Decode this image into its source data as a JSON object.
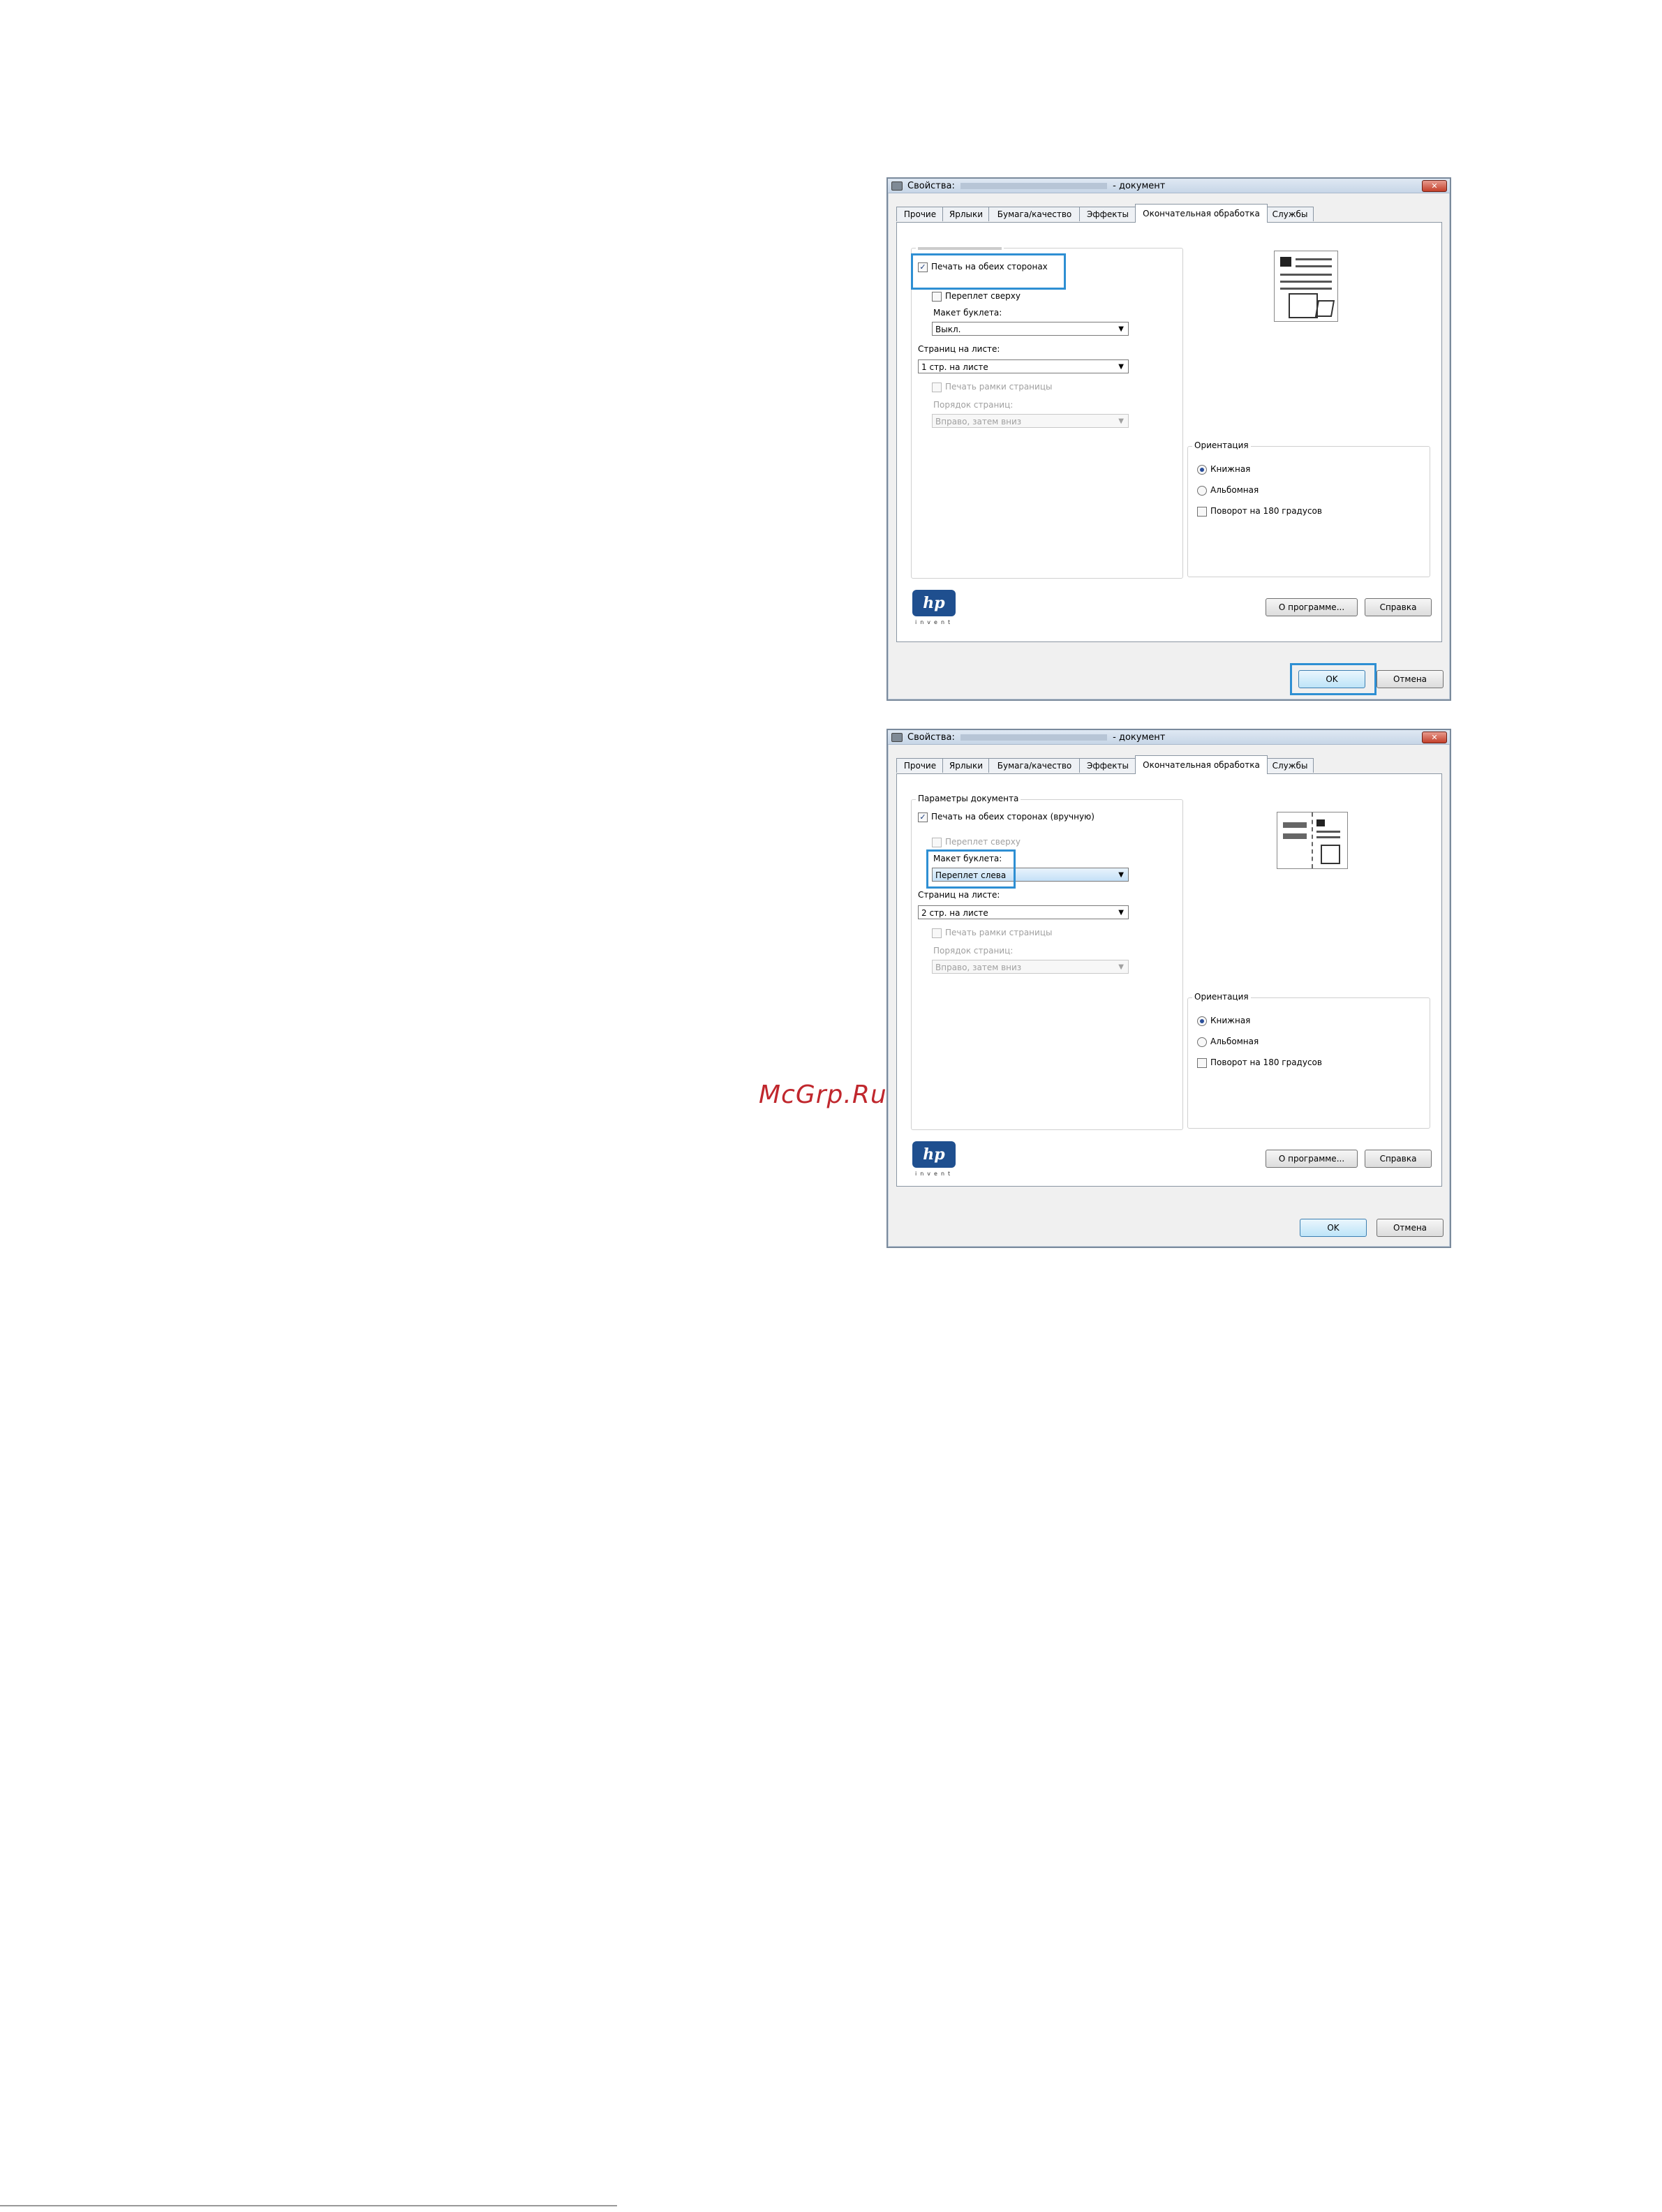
{
  "dialog1": {
    "title_prefix": "Свойства:",
    "title_suffix": "- документ",
    "close": "✕",
    "tabs": [
      "Прочие",
      "Ярлыки",
      "Бумага/качество",
      "Эффекты",
      "Окончательная обработка",
      "Службы"
    ],
    "active_tab": "Окончательная обработка",
    "doc_group_legend": "",
    "duplex_label": "Печать на обеих сторонах",
    "duplex_checked": "✓",
    "flip_label": "Переплет сверху",
    "booklet_label": "Макет буклета:",
    "booklet_value": "Выкл.",
    "pages_label": "Страниц на листе:",
    "pages_value": "1 стр. на листе",
    "border_label": "Печать рамки страницы",
    "order_label": "Порядок страниц:",
    "order_value": "Вправо, затем вниз",
    "orientation_legend": "Ориентация",
    "portrait_label": "Книжная",
    "landscape_label": "Альбомная",
    "rotate_label": "Поворот на 180 градусов",
    "about_button": "О программе...",
    "help_button": "Справка",
    "ok_button": "OK",
    "cancel_button": "Отмена"
  },
  "dialog2": {
    "title_prefix": "Свойства:",
    "title_suffix": "- документ",
    "close": "✕",
    "tabs": [
      "Прочие",
      "Ярлыки",
      "Бумага/качество",
      "Эффекты",
      "Окончательная обработка",
      "Службы"
    ],
    "active_tab": "Окончательная обработка",
    "doc_group_legend": "Параметры документа",
    "duplex_label": "Печать на обеих сторонах (вручную)",
    "duplex_checked": "✓",
    "flip_label": "Переплет сверху",
    "booklet_label": "Макет буклета:",
    "booklet_value": "Переплет слева",
    "pages_label": "Страниц на листе:",
    "pages_value": "2 стр. на листе",
    "border_label": "Печать рамки страницы",
    "order_label": "Порядок страниц:",
    "order_value": "Вправо, затем вниз",
    "orientation_legend": "Ориентация",
    "portrait_label": "Книжная",
    "landscape_label": "Альбомная",
    "rotate_label": "Поворот на 180 градусов",
    "about_button": "О программе...",
    "help_button": "Справка",
    "ok_button": "OK",
    "cancel_button": "Отмена"
  },
  "logo_text": "hp",
  "logo_tagline": "invent",
  "watermark": "McGrp.Ru",
  "colors": {
    "highlight": "#2e8fd3",
    "watermark": "#c0272d",
    "hp_blue": "#1f4f8f"
  }
}
